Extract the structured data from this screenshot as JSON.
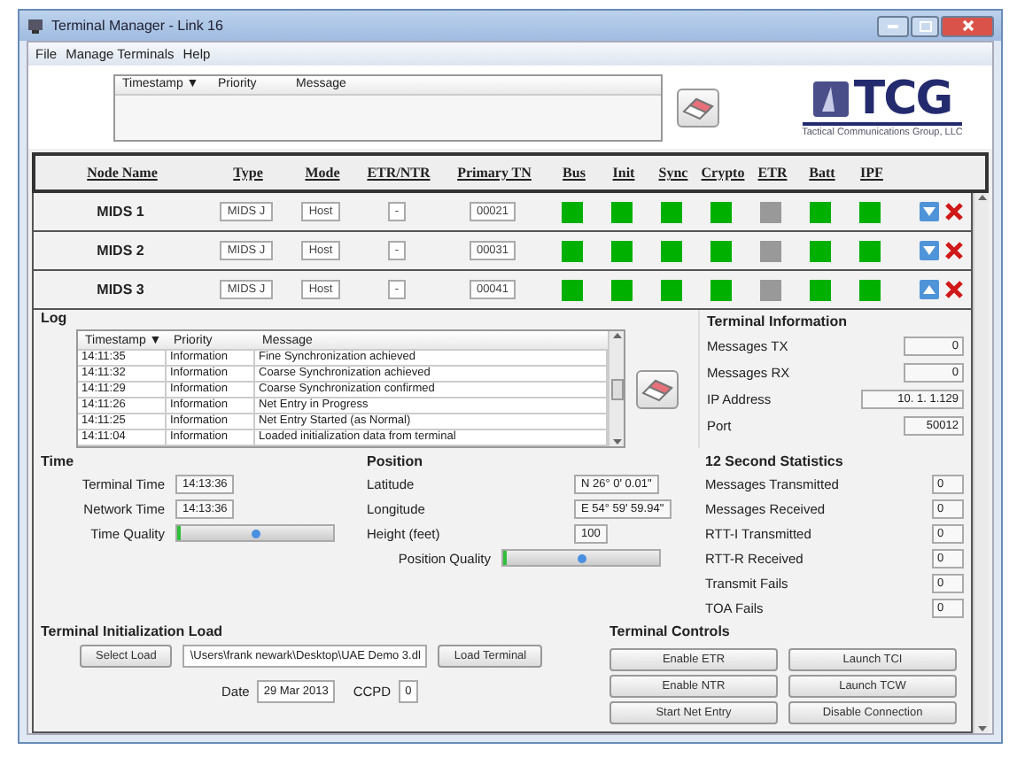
{
  "window": {
    "title": "Terminal Manager - Link 16"
  },
  "menu": [
    "File",
    "Manage Terminals",
    "Help"
  ],
  "message_table": {
    "columns": [
      "Timestamp ▼",
      "Priority",
      "Message"
    ]
  },
  "logo": {
    "name": "TCG",
    "tagline": "Tactical Communications Group, LLC"
  },
  "node_columns": [
    "Node Name",
    "Type",
    "Mode",
    "ETR/NTR",
    "Primary TN",
    "Bus",
    "Init",
    "Sync",
    "Crypto",
    "ETR",
    "Batt",
    "IPF"
  ],
  "nodes": [
    {
      "name": "MIDS 1",
      "type": "MIDS J",
      "mode": "Host",
      "etr_ntr": "-",
      "primary_tn": "00021",
      "expanded": false,
      "indicators": [
        {
          "color": "#00b000"
        },
        {
          "color": "#00b000"
        },
        {
          "color": "#00b000"
        },
        {
          "color": "#00b000"
        },
        {
          "color": "#999999"
        },
        {
          "color": "#00b000"
        },
        {
          "color": "#00b000"
        }
      ]
    },
    {
      "name": "MIDS 2",
      "type": "MIDS J",
      "mode": "Host",
      "etr_ntr": "-",
      "primary_tn": "00031",
      "expanded": false,
      "indicators": [
        {
          "color": "#00b000"
        },
        {
          "color": "#00b000"
        },
        {
          "color": "#00b000"
        },
        {
          "color": "#00b000"
        },
        {
          "color": "#999999"
        },
        {
          "color": "#00b000"
        },
        {
          "color": "#00b000"
        }
      ]
    },
    {
      "name": "MIDS 3",
      "type": "MIDS J",
      "mode": "Host",
      "etr_ntr": "-",
      "primary_tn": "00041",
      "expanded": true,
      "indicators": [
        {
          "color": "#00b000"
        },
        {
          "color": "#00b000"
        },
        {
          "color": "#00b000"
        },
        {
          "color": "#00b000"
        },
        {
          "color": "#999999"
        },
        {
          "color": "#00b000"
        },
        {
          "color": "#00b000"
        }
      ]
    }
  ],
  "details": {
    "log": {
      "title": "Log",
      "columns": [
        "Timestamp ▼",
        "Priority",
        "Message"
      ],
      "rows": [
        [
          "14:11:35",
          "Information",
          "Fine Synchronization achieved"
        ],
        [
          "14:11:32",
          "Information",
          "Coarse Synchronization achieved"
        ],
        [
          "14:11:29",
          "Information",
          "Coarse Synchronization confirmed"
        ],
        [
          "14:11:26",
          "Information",
          "Net Entry in Progress"
        ],
        [
          "14:11:25",
          "Information",
          "Net Entry Started (as Normal)"
        ],
        [
          "14:11:04",
          "Information",
          "Loaded initialization data from terminal"
        ]
      ]
    },
    "terminal_information": {
      "title": "Terminal Information",
      "fields": [
        {
          "label": "Messages TX",
          "value": "0"
        },
        {
          "label": "Messages RX",
          "value": "0"
        },
        {
          "label": "IP Address",
          "value": "10.  1.  1.129"
        },
        {
          "label": "Port",
          "value": "50012"
        }
      ]
    },
    "time": {
      "title": "Time",
      "fields": [
        {
          "label": "Terminal Time",
          "value": "14:13:36"
        },
        {
          "label": "Network Time",
          "value": "14:13:36"
        }
      ],
      "quality": {
        "label": "Time Quality",
        "level": 0.02
      }
    },
    "position": {
      "title": "Position",
      "fields": [
        {
          "label": "Latitude",
          "value": "N 26° 0' 0.01\""
        },
        {
          "label": "Longitude",
          "value": "E 54° 59' 59.94\""
        },
        {
          "label": "Height (feet)",
          "value": "100"
        }
      ],
      "quality": {
        "label": "Position Quality",
        "level": 0.02
      }
    },
    "statistics": {
      "title": "12 Second Statistics",
      "rows": [
        {
          "label": "Messages Transmitted",
          "value": "0"
        },
        {
          "label": "Messages Received",
          "value": "0"
        },
        {
          "label": "RTT-I Transmitted",
          "value": "0"
        },
        {
          "label": "RTT-R Received",
          "value": "0"
        },
        {
          "label": "Transmit Fails",
          "value": "0"
        },
        {
          "label": "TOA Fails",
          "value": "0"
        }
      ]
    },
    "init_load": {
      "title": "Terminal Initialization Load",
      "select_button": "Select Load",
      "path": "\\Users\\frank newark\\Desktop\\UAE Demo 3.dl",
      "load_button": "Load Terminal",
      "date_label": "Date",
      "date": "29 Mar 2013",
      "ccpd_label": "CCPD",
      "ccpd": "0"
    },
    "controls": {
      "title": "Terminal Controls",
      "buttons": [
        "Enable ETR",
        "Launch TCI",
        "Enable NTR",
        "Launch TCW",
        "Start Net Entry",
        "Disable Connection"
      ]
    }
  }
}
